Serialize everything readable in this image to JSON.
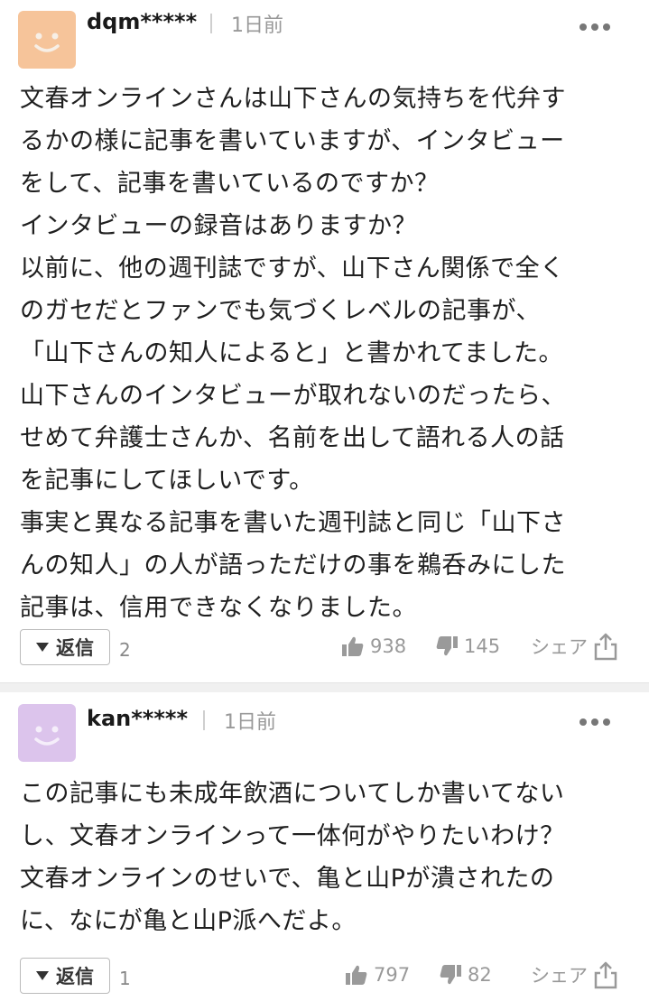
{
  "comments": [
    {
      "username": "dqm*****",
      "time": "1日前",
      "avatar_color": "#f6c49a",
      "avatar_icon": "smiley-face-icon",
      "lines": [
        "文春オンラインさんは山下さんの気持ちを代弁す",
        "るかの様に記事を書いていますが、インタビュー",
        "をして、記事を書いているのですか？",
        "インタビューの録音はありますか？",
        "以前に、他の週刊誌ですが、山下さん関係で全く",
        "のガセだとファンでも気づくレベルの記事が、",
        "「山下さんの知人によると」と書かれてました。",
        "山下さんのインタビューが取れないのだったら、",
        "せめて弁護士さんか、名前を出して語れる人の話",
        "を記事にしてほしいです。",
        "事実と異なる記事を書いた週刊誌と同じ「山下さ",
        "んの知人」の人が語っただけの事を鵜呑みにした",
        "記事は、信用できなくなりました。"
      ],
      "reply_label": "返信",
      "reply_count": "2",
      "likes": "938",
      "dislikes": "145",
      "share_label": "シェア"
    },
    {
      "username": "kan*****",
      "time": "1日前",
      "avatar_color": "#dcc4ec",
      "avatar_icon": "smiley-face-icon",
      "lines": [
        "この記事にも未成年飲酒についてしか書いてない",
        "し、文春オンラインって一体何がやりたいわけ？",
        "文春オンラインのせいで、亀と山Pが潰されたの",
        "に、なにが亀と山P派へだよ。"
      ],
      "reply_label": "返信",
      "reply_count": "1",
      "likes": "797",
      "dislikes": "82",
      "share_label": "シェア"
    }
  ]
}
